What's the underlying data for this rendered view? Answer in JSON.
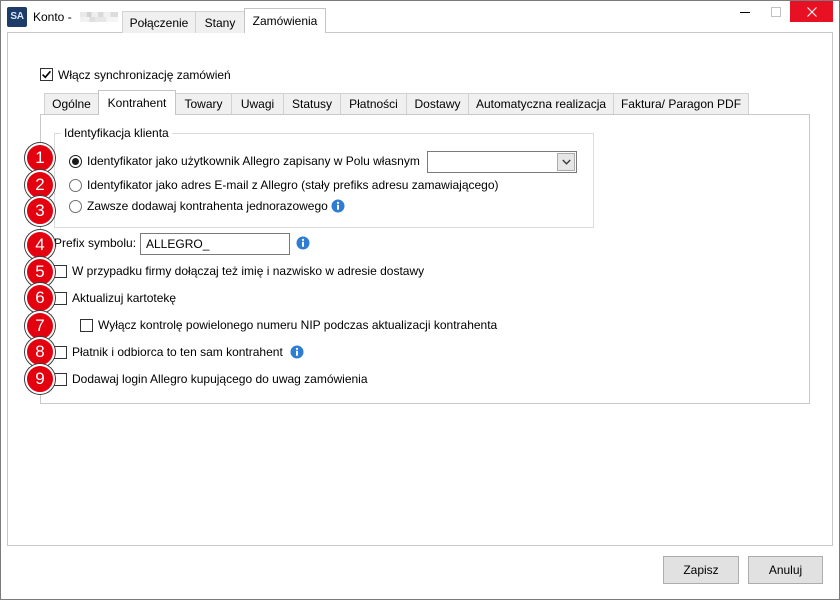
{
  "window": {
    "app_icon_text": "SA",
    "title": "Konto -",
    "tabs": [
      {
        "label": "Połączenie",
        "selected": false
      },
      {
        "label": "Stany",
        "selected": false
      },
      {
        "label": "Zamówienia",
        "selected": true
      }
    ],
    "controls": {
      "maximize_disabled": true
    }
  },
  "orders": {
    "sync": {
      "label": "Włącz synchronizację zamówień",
      "checked": true
    },
    "tabs": [
      {
        "label": "Ogólne",
        "selected": false
      },
      {
        "label": "Kontrahent",
        "selected": true
      },
      {
        "label": "Towary",
        "selected": false
      },
      {
        "label": "Uwagi",
        "selected": false
      },
      {
        "label": "Statusy",
        "selected": false
      },
      {
        "label": "Płatności",
        "selected": false
      },
      {
        "label": "Dostawy",
        "selected": false
      },
      {
        "label": "Automatyczna realizacja",
        "selected": false
      },
      {
        "label": "Faktura/ Paragon PDF",
        "selected": false
      }
    ],
    "contractor": {
      "client_identification": {
        "title": "Identyfikacja klienta",
        "options": [
          {
            "label": "Identyfikator jako użytkownik Allegro zapisany w Polu własnym",
            "selected": true
          },
          {
            "label": "Identyfikator jako adres E-mail z Allegro (stały prefiks adresu zamawiającego)",
            "selected": false
          },
          {
            "label": "Zawsze dodawaj kontrahenta jednorazowego",
            "selected": false
          }
        ],
        "custom_field": {
          "value": ""
        }
      },
      "prefix": {
        "label": "Prefix symbolu:",
        "value": "ALLEGRO_"
      },
      "options": [
        {
          "label": "W przypadku firmy dołączaj też imię i nazwisko w adresie dostawy",
          "checked": false
        },
        {
          "label": "Aktualizuj kartotekę",
          "checked": false
        },
        {
          "label": "Wyłącz kontrolę powielonego numeru NIP podczas aktualizacji kontrahenta",
          "checked": false
        },
        {
          "label": "Płatnik i odbiorca to ten sam kontrahent",
          "checked": false
        },
        {
          "label": "Dodawaj login Allegro kupującego do uwag zamówienia",
          "checked": false
        }
      ]
    }
  },
  "annotations": [
    "1",
    "2",
    "3",
    "4",
    "5",
    "6",
    "7",
    "8",
    "9"
  ],
  "footer": {
    "save_label": "Zapisz",
    "cancel_label": "Anuluj"
  },
  "icons": {
    "app": "app-icon",
    "minimize": "minimize-icon",
    "maximize": "maximize-icon",
    "close": "close-icon",
    "checkmark": "checkmark-icon",
    "dropdown": "chevron-down-icon",
    "info": "info-icon"
  },
  "colors": {
    "close": "#e81123",
    "annotation": "#e3000f",
    "info": "#2f7dd3",
    "app-icon": "#1d3c68"
  }
}
